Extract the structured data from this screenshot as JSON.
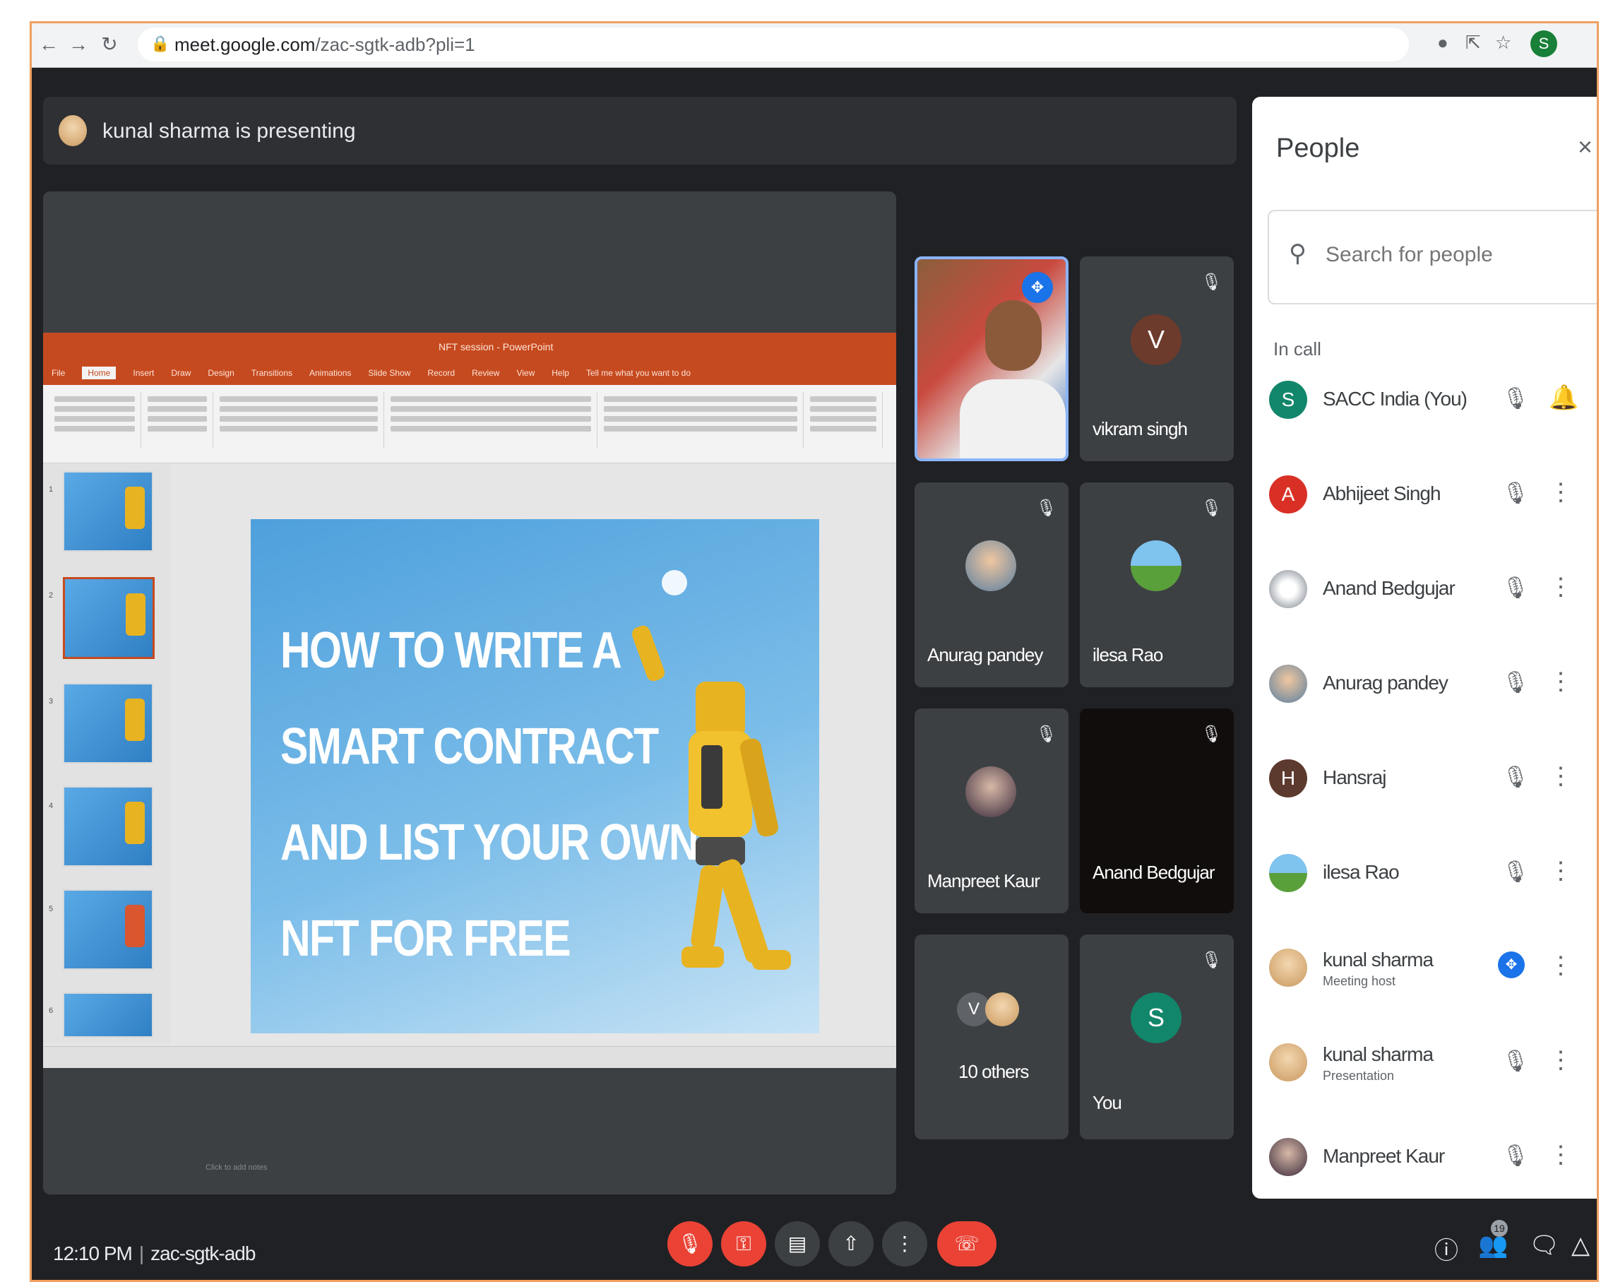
{
  "browser": {
    "url_host": "meet.google.com",
    "url_path": "/zac-sgtk-adb?pli=1",
    "profile_initial": "S"
  },
  "presenter_bar": {
    "text": "kunal sharma is presenting"
  },
  "slide": {
    "title_lines": [
      "HOW TO WRITE A",
      "SMART CONTRACT",
      "AND LIST YOUR OWN",
      "NFT FOR FREE"
    ],
    "notes_placeholder": "Click to add notes",
    "app_title": "NFT session - PowerPoint",
    "ribbon_tabs": [
      "File",
      "Home",
      "Insert",
      "Draw",
      "Design",
      "Transitions",
      "Animations",
      "Slide Show",
      "Record",
      "Review",
      "View",
      "Help",
      "Tell me what you want to do"
    ]
  },
  "tiles": [
    {
      "name": "",
      "type": "camera"
    },
    {
      "name": "vikram singh",
      "initial": "V",
      "color": "#6d3b2c",
      "muted": true
    },
    {
      "name": "Anurag pandey",
      "muted": true
    },
    {
      "name": "ilesa Rao",
      "muted": true
    },
    {
      "name": "Manpreet Kaur",
      "muted": true
    },
    {
      "name": "Anand Bedgujar",
      "muted": true
    },
    {
      "name": "10 others",
      "initial": "V"
    },
    {
      "name": "You",
      "initial": "S",
      "color": "#12866a",
      "muted": true
    }
  ],
  "people_panel": {
    "title": "People",
    "search_placeholder": "Search for people",
    "section": "In call",
    "participants": [
      {
        "name": "SACC India (You)",
        "initial": "S",
        "color": "#12866a",
        "sub": ""
      },
      {
        "name": "Abhijeet Singh",
        "initial": "A",
        "color": "#d93025",
        "sub": ""
      },
      {
        "name": "Anand Bedgujar",
        "initial": "",
        "color": "#9aa0a6",
        "sub": ""
      },
      {
        "name": "Anurag pandey",
        "initial": "",
        "color": "#8d9aa6",
        "sub": ""
      },
      {
        "name": "Hansraj",
        "initial": "H",
        "color": "#5d3a2e",
        "sub": ""
      },
      {
        "name": "ilesa Rao",
        "initial": "",
        "color": "#6fb0d6",
        "sub": ""
      },
      {
        "name": "kunal sharma",
        "initial": "",
        "color": "#c9985e",
        "sub": "Meeting host"
      },
      {
        "name": "kunal sharma",
        "initial": "",
        "color": "#c9985e",
        "sub": "Presentation"
      },
      {
        "name": "Manpreet Kaur",
        "initial": "",
        "color": "#3a2a3a",
        "sub": ""
      }
    ]
  },
  "bottom_bar": {
    "time": "12:10 PM",
    "meeting_code": "zac-sgtk-adb",
    "people_count": "19"
  },
  "colors": {
    "accent": "#1a73e8",
    "danger": "#ea4335",
    "frame": "#f0a060",
    "ppt": "#c64a1f"
  }
}
